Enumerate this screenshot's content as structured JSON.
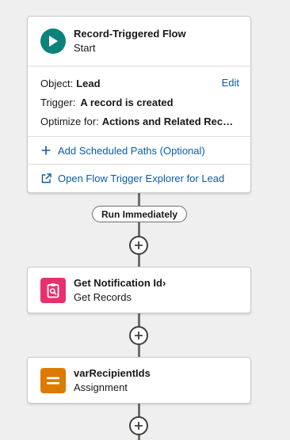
{
  "start_node": {
    "title": "Record-Triggered Flow",
    "subtitle": "Start",
    "icon": "play-icon",
    "icon_color": "#0b827c",
    "object_label": "Object:",
    "object_value": "Lead",
    "edit_label": "Edit",
    "trigger_label": "Trigger:",
    "trigger_value": "A record is created",
    "optimize_label": "Optimize for:",
    "optimize_value": "Actions and Related Records",
    "add_paths_label": "Add Scheduled Paths (Optional)",
    "explorer_label": "Open Flow Trigger Explorer for Lead"
  },
  "path_pill": {
    "label": "Run Immediately"
  },
  "nodes": [
    {
      "title": "Get Notification Id›",
      "subtitle": "Get Records",
      "icon": "clipboard-search-icon",
      "icon_color": "#e8306f"
    },
    {
      "title": "varRecipientIds",
      "subtitle": "Assignment",
      "icon": "equals-icon",
      "icon_color": "#dd7a01"
    }
  ],
  "colors": {
    "canvas": "#efefef",
    "link": "#0b5cab",
    "connector": "#706e6b"
  }
}
